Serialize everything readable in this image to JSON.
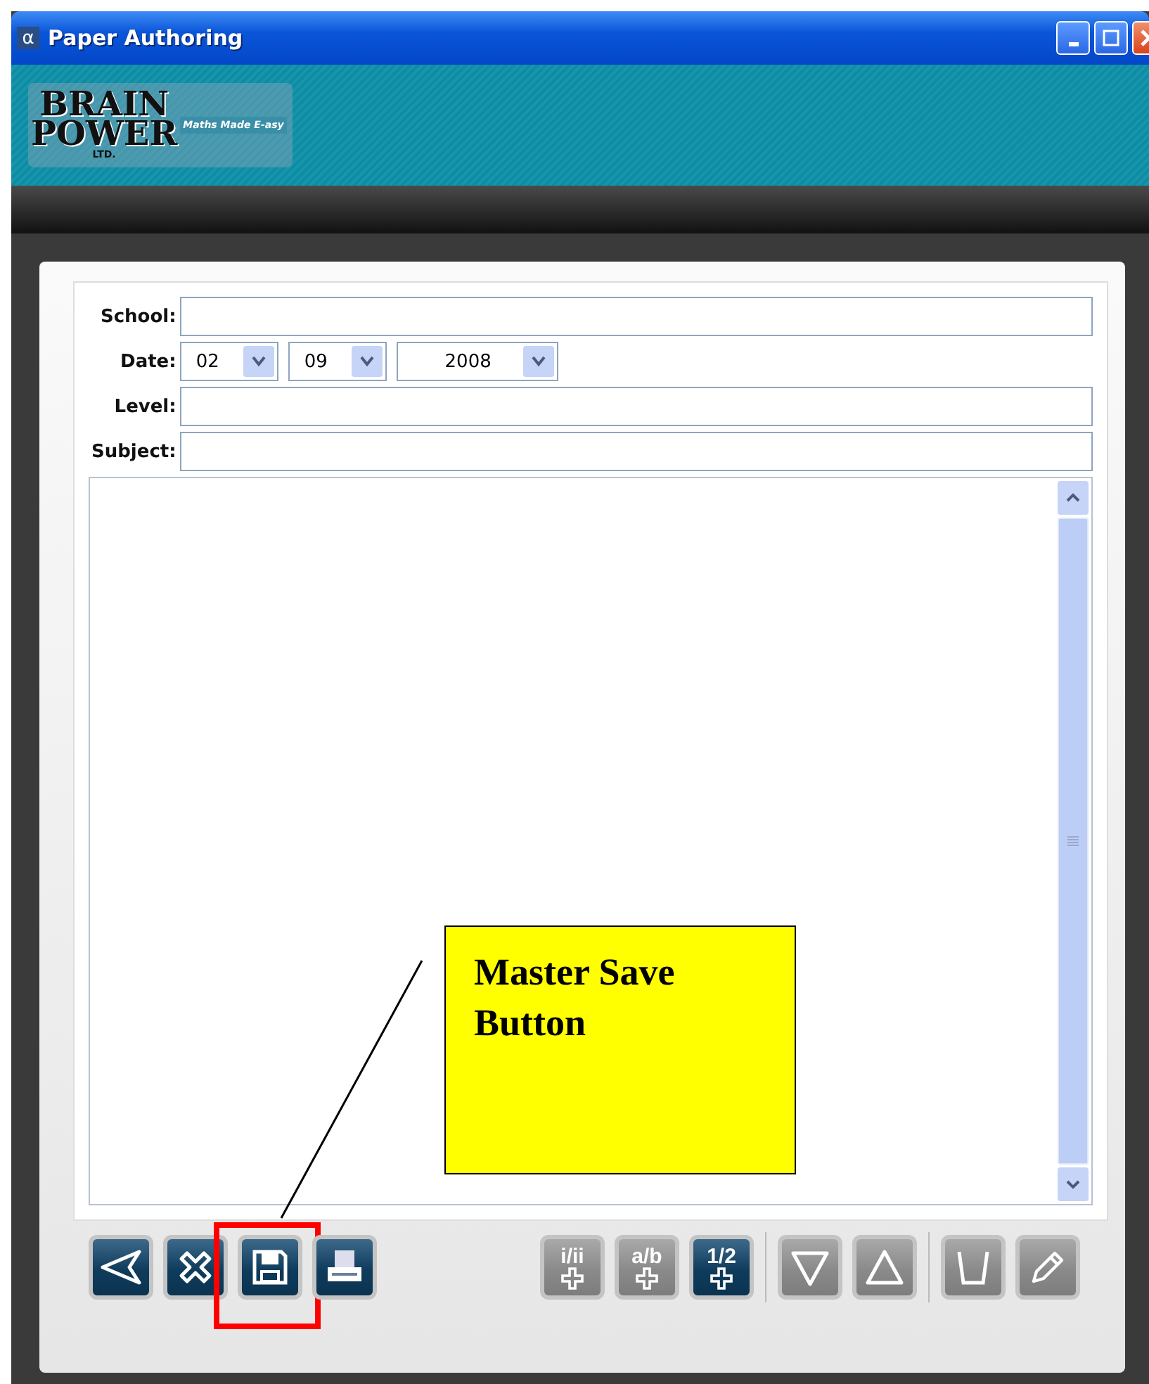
{
  "window": {
    "title": "Paper Authoring",
    "icon": "α"
  },
  "banner": {
    "logo_lines": [
      "BRAIN",
      "POWER"
    ],
    "logo_suffix": "LTD.",
    "tagline": "Maths Made E-asy"
  },
  "form": {
    "fields": [
      {
        "kind": "text",
        "label": "School:"
      },
      {
        "kind": "date",
        "label": "Date:",
        "parts": [
          {
            "value": "02"
          },
          {
            "value": "09"
          },
          {
            "value": "2008"
          }
        ]
      },
      {
        "kind": "text",
        "label": "Level:"
      },
      {
        "kind": "text",
        "label": "Subject:"
      }
    ]
  },
  "toolbar": [
    [
      {
        "kind": "back",
        "disabled": false,
        "highlighted": false
      },
      {
        "kind": "delete",
        "disabled": false,
        "highlighted": false
      },
      {
        "kind": "save",
        "disabled": false,
        "highlighted": true
      },
      {
        "kind": "print",
        "disabled": false,
        "highlighted": false
      }
    ],
    [
      {
        "kind": "add",
        "label": "i/ii",
        "disabled": true,
        "highlighted": false
      },
      {
        "kind": "add",
        "label": "a/b",
        "disabled": true,
        "highlighted": false
      },
      {
        "kind": "add",
        "label": "1/2",
        "disabled": false,
        "highlighted": false
      }
    ],
    [
      {
        "kind": "down",
        "disabled": true,
        "highlighted": false
      },
      {
        "kind": "up",
        "disabled": true,
        "highlighted": false
      }
    ],
    [
      {
        "kind": "cup",
        "disabled": true,
        "highlighted": false
      },
      {
        "kind": "pencil",
        "disabled": true,
        "highlighted": false
      }
    ]
  ],
  "annotation": {
    "text": "Master Save Button"
  }
}
